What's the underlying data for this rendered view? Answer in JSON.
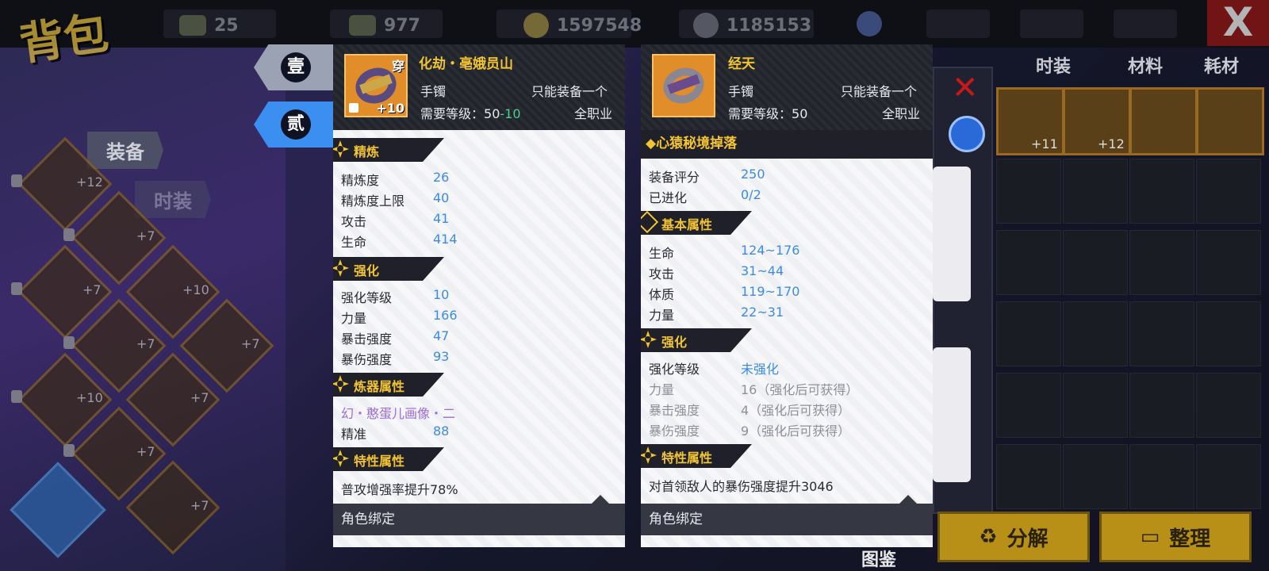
{
  "top": {
    "title": "背包",
    "currencies": [
      {
        "icon": "cash-icon",
        "value": "25"
      },
      {
        "icon": "cash-icon",
        "value": "977"
      },
      {
        "icon": "gold-coin-icon",
        "value": "1597548"
      },
      {
        "icon": "silver-coin-icon",
        "value": "1185153"
      }
    ],
    "close": "X"
  },
  "left": {
    "tag_equip": "装备",
    "tag_fashion": "时装",
    "slots": [
      "+12",
      "+7",
      "+7",
      "+10",
      "+7",
      "+7",
      "+10",
      "+7",
      "+7",
      "+7"
    ]
  },
  "right": {
    "tabs": [
      "时装",
      "材料",
      "耗材"
    ],
    "top_slots": [
      "+11",
      "+12",
      "",
      ""
    ],
    "btn_decompose": "分解",
    "btn_sort": "整理",
    "tujian": "图鉴"
  },
  "switch": {
    "one": "壹",
    "two": "贰"
  },
  "item1": {
    "badge_wear": "穿",
    "plus": "+10",
    "name": "化劫・亳娥员山",
    "type": "手镯",
    "limit": "只能装备一个",
    "level_label": "需要等级：",
    "level": "50",
    "level_bonus": "-10",
    "class": "全职业",
    "sections": {
      "refine": "精炼",
      "enhance": "强化",
      "forge": "炼器属性",
      "trait": "特性属性"
    },
    "refine_rows": [
      {
        "k": "精炼度",
        "v": "26"
      },
      {
        "k": "精炼度上限",
        "v": "40"
      },
      {
        "k": "攻击",
        "v": "41"
      },
      {
        "k": "生命",
        "v": "414"
      }
    ],
    "enhance_rows": [
      {
        "k": "强化等级",
        "v": "10"
      },
      {
        "k": "力量",
        "v": "166"
      },
      {
        "k": "暴击强度",
        "v": "47"
      },
      {
        "k": "暴伤强度",
        "v": "93"
      }
    ],
    "forge_name": "幻・憨蛋儿画像・二",
    "forge_row": {
      "k": "精准",
      "v": "88"
    },
    "trait_text": "普攻增强率提升78%",
    "bind": "角色绑定"
  },
  "item2": {
    "name": "经天",
    "type": "手镯",
    "limit": "只能装备一个",
    "level_label": "需要等级：",
    "level": "50",
    "class": "全职业",
    "drop": "◆心猿秘境掉落",
    "score_rows": [
      {
        "k": "装备评分",
        "v": "250"
      },
      {
        "k": "已进化",
        "v": "0/2"
      }
    ],
    "sections": {
      "base": "基本属性",
      "enhance": "强化",
      "trait": "特性属性"
    },
    "base_rows": [
      {
        "k": "生命",
        "v": "124~176"
      },
      {
        "k": "攻击",
        "v": "31~44"
      },
      {
        "k": "体质",
        "v": "119~170"
      },
      {
        "k": "力量",
        "v": "22~31"
      }
    ],
    "enhance_level": {
      "k": "强化等级",
      "v": "未强化"
    },
    "enhance_grey": [
      {
        "k": "力量",
        "v": "16（强化后可获得）"
      },
      {
        "k": "暴击强度",
        "v": "4（强化后可获得）"
      },
      {
        "k": "暴伤强度",
        "v": "9（强化后可获得）"
      }
    ],
    "trait_text": "对首领敌人的暴伤强度提升3046",
    "bind": "角色绑定"
  },
  "colors": {
    "accent_gold": "#f2c431",
    "value_blue": "#3a8be8",
    "tab_blue": "#3b8ff0"
  }
}
